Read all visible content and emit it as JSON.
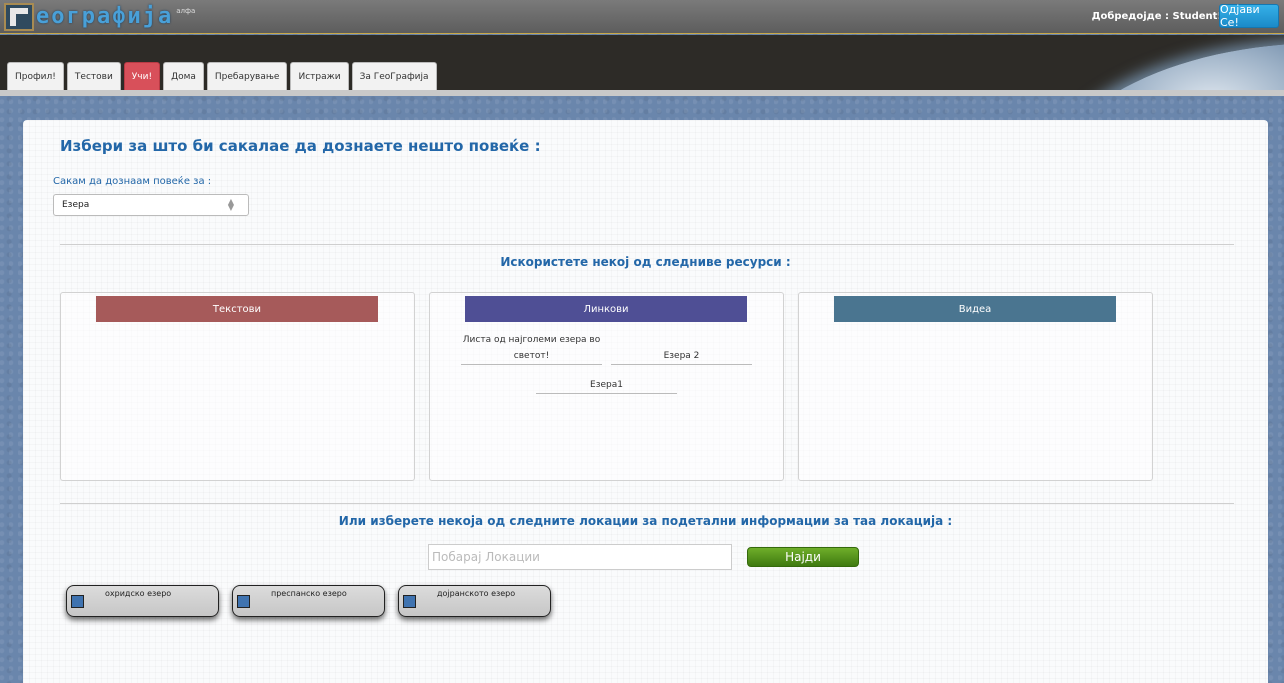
{
  "header": {
    "logo_text": "еографија",
    "logo_sup": "алфа",
    "welcome": "Добредојде : Student!",
    "logout_label": "Одјави Се!"
  },
  "nav": {
    "tabs": [
      {
        "label": "Профил!",
        "active": false
      },
      {
        "label": "Тестови",
        "active": false
      },
      {
        "label": "Учи!",
        "active": true
      },
      {
        "label": "Дома",
        "active": false
      },
      {
        "label": "Пребарување",
        "active": false
      },
      {
        "label": "Истражи",
        "active": false
      },
      {
        "label": "За ГеоГрафија",
        "active": false
      }
    ]
  },
  "main": {
    "title": "Избери за што би сакалае да дознаете нешто повеќе :",
    "select_label": "Сакам да дознаам повеќе за :",
    "select_value": "Езера",
    "resources_title": "Искористете некој од следниве ресурси :",
    "resources": [
      {
        "title": "Текстови",
        "color": "#a65a5a",
        "links": []
      },
      {
        "title": "Линкови",
        "color": "#4f4f95",
        "links": [
          "Листа од најголеми езера во светот!",
          "Езера 2",
          "Езера1"
        ]
      },
      {
        "title": "Видеа",
        "color": "#4a7590",
        "links": []
      }
    ],
    "locations_title": "Или изберете некоја од следните локации за подетални информации за таа локација :",
    "search_placeholder": "Побарај Локации",
    "find_label": "Најди",
    "locations": [
      "охридско езеро",
      "преспанско езеро",
      "дојранското езеро"
    ]
  }
}
